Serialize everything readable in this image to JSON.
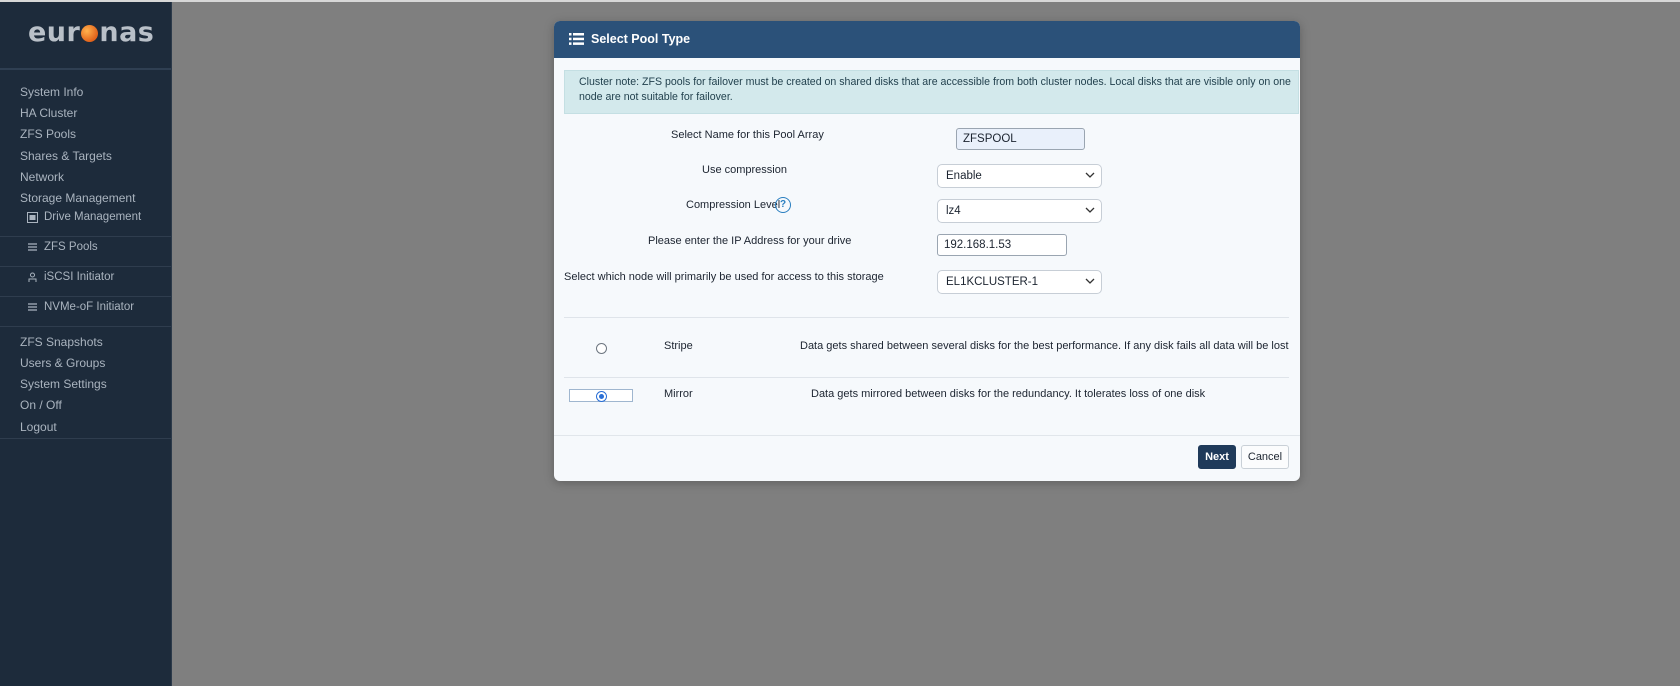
{
  "brand": {
    "logo_pre": "eur",
    "logo_post": "nas"
  },
  "sidebar": {
    "items": [
      {
        "label": "System Info"
      },
      {
        "label": "HA Cluster"
      },
      {
        "label": "ZFS Pools"
      },
      {
        "label": "Shares & Targets"
      },
      {
        "label": "Network"
      },
      {
        "label": "Storage Management"
      }
    ],
    "sub_items": [
      {
        "label": "Drive Management",
        "icon": "drive-icon"
      },
      {
        "label": "ZFS Pools",
        "icon": "pool-icon"
      },
      {
        "label": "iSCSI Initiator",
        "icon": "initiator-icon"
      },
      {
        "label": "NVMe-oF Initiator",
        "icon": "pool-icon"
      }
    ],
    "items_after": [
      {
        "label": "ZFS Snapshots"
      },
      {
        "label": "Users & Groups"
      },
      {
        "label": "System Settings"
      },
      {
        "label": "On / Off"
      },
      {
        "label": "Logout"
      }
    ]
  },
  "modal": {
    "title": "Select Pool Type",
    "note": "Cluster note: ZFS pools for failover must be created on shared disks that are accessible from both cluster nodes. Local disks that are visible only on one node are not suitable for failover.",
    "fields": {
      "name_label": "Select Name for this Pool Array",
      "name_value": "ZFSPOOL",
      "compression_label": "Use compression",
      "compression_value": "Enable",
      "level_label": "Compression Level",
      "level_value": "lz4",
      "ip_label": "Please enter the IP Address for your drive",
      "ip_value": "192.168.1.53",
      "node_label": "Select which node will primarily be used for access to this storage",
      "node_value": "EL1KCLUSTER-1"
    },
    "options": [
      {
        "name": "Stripe",
        "desc": "Data gets shared between several disks for the best performance. If any disk fails all data will be lost",
        "selected": false
      },
      {
        "name": "Mirror",
        "desc": "Data gets mirrored between disks for the redundancy. It tolerates loss of one disk",
        "selected": true
      }
    ],
    "buttons": {
      "next": "Next",
      "cancel": "Cancel"
    }
  },
  "colors": {
    "sidebar_bg": "#1d2b3b",
    "overlay": "#7f7f7f",
    "header_bg": "#2b5179",
    "note_bg": "#d3e9ec",
    "primary_button": "#1f3a5a",
    "accent_orange": "#e2631b"
  }
}
